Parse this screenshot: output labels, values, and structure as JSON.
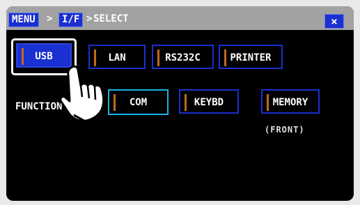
{
  "breadcrumb": {
    "menu_label": "MENU",
    "sep1": ">",
    "interface_label": "I/F",
    "sep2": ">",
    "current_label": "SELECT"
  },
  "close_label": "×",
  "interface_buttons": [
    {
      "label": "USB",
      "selected": true
    },
    {
      "label": "LAN",
      "selected": false
    },
    {
      "label": "RS232C",
      "selected": false
    },
    {
      "label": "PRINTER",
      "selected": false
    }
  ],
  "function": {
    "label": "FUNCTION",
    "buttons": [
      {
        "label": "COM",
        "selected": true
      },
      {
        "label": "KEYBD",
        "selected": false
      },
      {
        "label": "MEMORY",
        "selected": false,
        "sublabel": "(FRONT)"
      }
    ]
  },
  "icons": {
    "close": "close-icon",
    "hand": "pointing-hand-icon"
  },
  "colors": {
    "accent": "#1a30d0",
    "highlight": "#19b3e5",
    "bar": "#c26a1d",
    "topbar": "#a2a2a2"
  }
}
